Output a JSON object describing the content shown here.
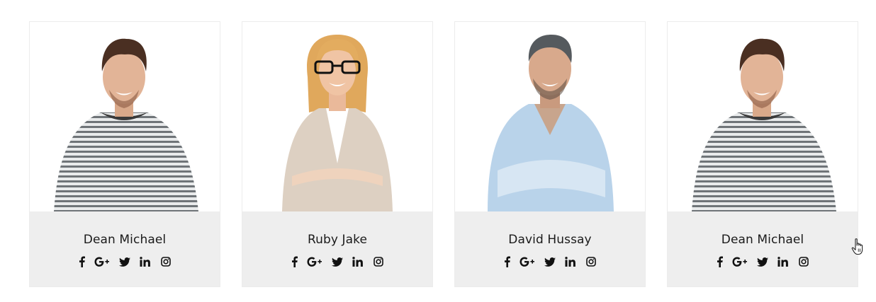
{
  "team": {
    "members": [
      {
        "name": "Dean Michael",
        "socials": [
          "facebook-icon",
          "google-plus-icon",
          "twitter-icon",
          "linkedin-icon",
          "instagram-icon"
        ]
      },
      {
        "name": "Ruby Jake",
        "socials": [
          "facebook-icon",
          "google-plus-icon",
          "twitter-icon",
          "linkedin-icon",
          "instagram-icon"
        ]
      },
      {
        "name": "David Hussay",
        "socials": [
          "facebook-icon",
          "google-plus-icon",
          "twitter-icon",
          "linkedin-icon",
          "instagram-icon"
        ]
      },
      {
        "name": "Dean Michael",
        "socials": [
          "facebook-icon",
          "google-plus-icon",
          "twitter-icon",
          "linkedin-icon",
          "instagram-icon"
        ]
      }
    ]
  },
  "colors": {
    "info_panel_bg": "#eeeeee",
    "card_border": "#ececec",
    "name_text": "#1a1a1a",
    "icon": "#111111"
  }
}
